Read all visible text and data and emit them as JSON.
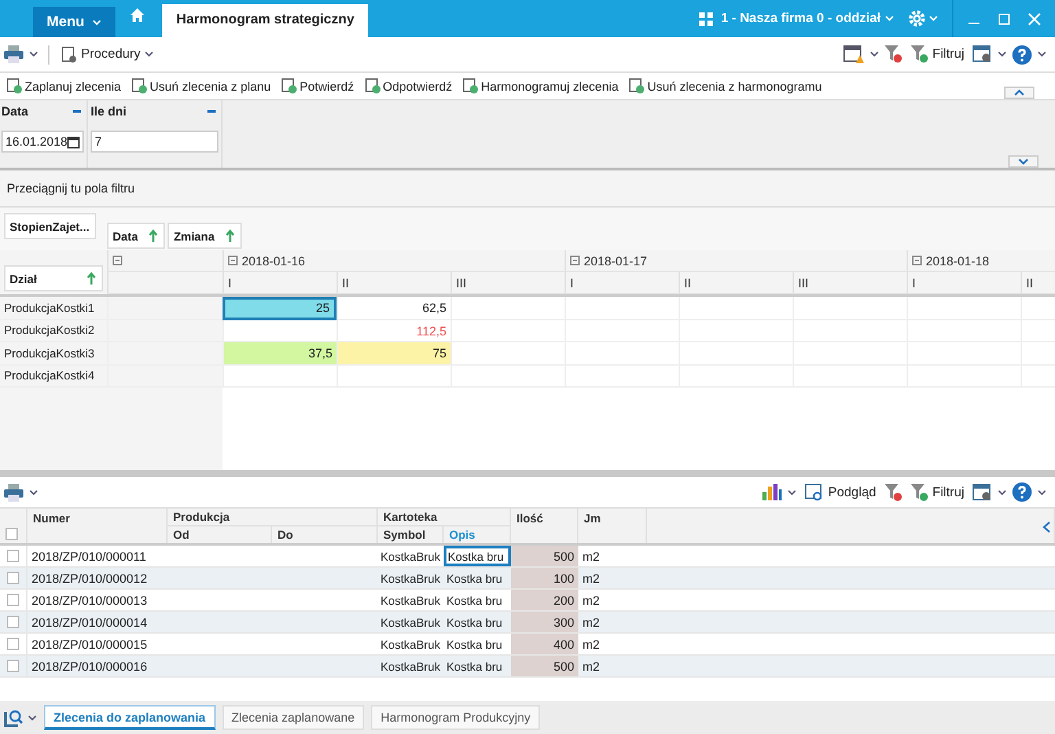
{
  "app": {
    "menu": "Menu",
    "tabs": [
      {
        "label": "Harmonogram strategiczny",
        "selected": true
      }
    ],
    "company": "1 - Nasza firma 0 - oddział"
  },
  "toolbar": {
    "procedures": "Procedury",
    "filter": "Filtruj"
  },
  "actions": [
    "Zaplanuj zlecenia",
    "Usuń zlecenia z planu",
    "Potwierdź",
    "Odpotwierdź",
    "Harmonogramuj zlecenia",
    "Usuń zlecenia z harmonogramu"
  ],
  "filters": [
    {
      "label": "Data",
      "value": "16.01.2018",
      "kind": "date"
    },
    {
      "label": "Ile dni",
      "value": "7",
      "kind": "text"
    }
  ],
  "pivot": {
    "drop_hint": "Przeciągnij tu pola filtru",
    "data_field": "StopienZajet...",
    "column_fields": [
      "Data",
      "Zmiana"
    ],
    "row_field": "Dział",
    "days": [
      {
        "label": "2018-01-16",
        "shifts": [
          "I",
          "II",
          "III"
        ]
      },
      {
        "label": "2018-01-17",
        "shifts": [
          "I",
          "II",
          "III"
        ]
      },
      {
        "label": "2018-01-18",
        "shifts": [
          "I",
          "II"
        ]
      }
    ],
    "rows": [
      {
        "label": "ProdukcjaKostki1",
        "cells": [
          {
            "value": "25",
            "color": "#7fdce8",
            "selected": true,
            "alert": false
          },
          {
            "value": "62,5",
            "selected": false,
            "alert": false
          }
        ]
      },
      {
        "label": "ProdukcjaKostki2",
        "cells": [
          {
            "selected": false
          },
          {
            "value": "112,5",
            "selected": false,
            "alert": true
          }
        ]
      },
      {
        "label": "ProdukcjaKostki3",
        "cells": [
          {
            "value": "37,5",
            "color": "#d2f7a0",
            "selected": false,
            "alert": false
          },
          {
            "value": "75",
            "color": "#fdf3a6",
            "selected": false,
            "alert": false
          }
        ]
      },
      {
        "label": "ProdukcjaKostki4",
        "cells": []
      }
    ]
  },
  "grid_toolbar": {
    "preview": "Podgląd",
    "filter": "Filtruj"
  },
  "grid": {
    "select_all_checked": false,
    "headers": {
      "numer": "Numer",
      "produkcja": "Produkcja",
      "od": "Od",
      "do": "Do",
      "kartoteka": "Kartoteka",
      "symbol": "Symbol",
      "opis": "Opis",
      "ilosc": "Ilość",
      "jm": "Jm"
    },
    "rows": [
      {
        "checked": false,
        "numer": "2018/ZP/010/000011",
        "symbol": "KostkaBruk",
        "opis": "Kostka bru",
        "ilosc": "500",
        "jm": "m2",
        "selected": true
      },
      {
        "checked": false,
        "numer": "2018/ZP/010/000012",
        "symbol": "KostkaBruk",
        "opis": "Kostka bru",
        "ilosc": "100",
        "jm": "m2",
        "selected": false
      },
      {
        "checked": false,
        "numer": "2018/ZP/010/000013",
        "symbol": "KostkaBruk",
        "opis": "Kostka bru",
        "ilosc": "200",
        "jm": "m2",
        "selected": false
      },
      {
        "checked": false,
        "numer": "2018/ZP/010/000014",
        "symbol": "KostkaBruk",
        "opis": "Kostka bru",
        "ilosc": "300",
        "jm": "m2",
        "selected": false
      },
      {
        "checked": false,
        "numer": "2018/ZP/010/000015",
        "symbol": "KostkaBruk",
        "opis": "Kostka bru",
        "ilosc": "400",
        "jm": "m2",
        "selected": false
      },
      {
        "checked": false,
        "numer": "2018/ZP/010/000016",
        "symbol": "KostkaBruk",
        "opis": "Kostka bru",
        "ilosc": "500",
        "jm": "m2",
        "selected": false
      }
    ]
  },
  "bottom_tabs": [
    {
      "label": "Zlecenia do zaplanowania",
      "selected": true
    },
    {
      "label": "Zlecenia zaplanowane",
      "selected": false
    },
    {
      "label": "Harmonogram Produkcyjny",
      "selected": false
    }
  ]
}
